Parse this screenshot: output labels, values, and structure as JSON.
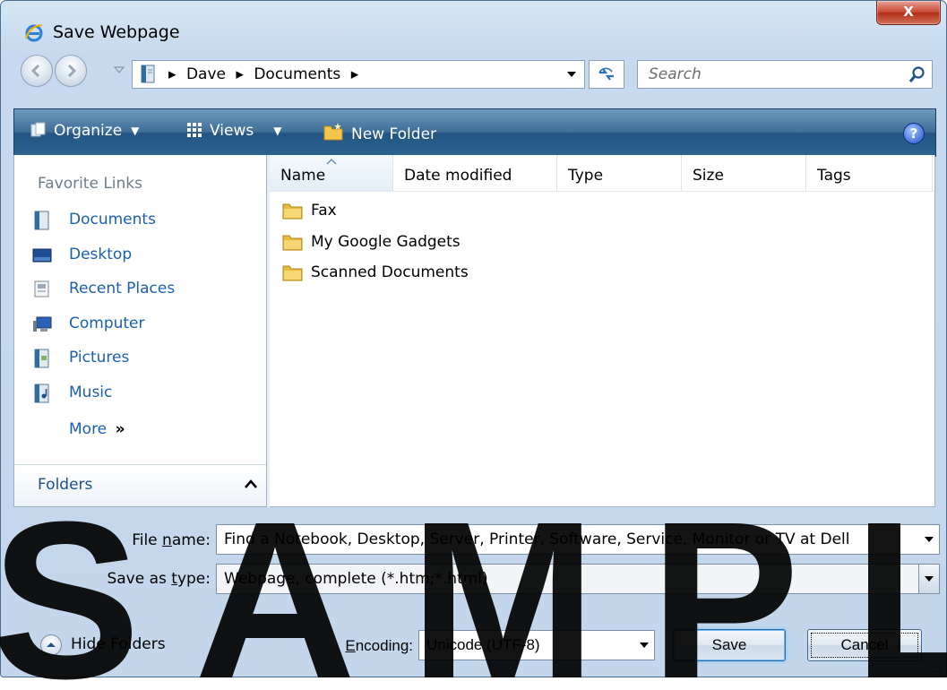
{
  "window": {
    "title": "Save Webpage",
    "close_label": "X"
  },
  "address": {
    "crumbs": [
      "Dave",
      "Documents"
    ],
    "search_placeholder": "Search"
  },
  "toolbar": {
    "organize_label": "Organize",
    "views_label": "Views",
    "new_folder_label": "New Folder",
    "help_label": "?"
  },
  "nav_pane": {
    "favorites_title": "Favorite Links",
    "favorites": [
      {
        "label": "Documents",
        "icon": "documents-icon"
      },
      {
        "label": "Desktop",
        "icon": "desktop-icon"
      },
      {
        "label": "Recent Places",
        "icon": "recent-places-icon"
      },
      {
        "label": "Computer",
        "icon": "computer-icon"
      },
      {
        "label": "Pictures",
        "icon": "pictures-icon"
      },
      {
        "label": "Music",
        "icon": "music-icon"
      }
    ],
    "more_label": "More",
    "more_glyph": "»",
    "folders_label": "Folders"
  },
  "file_list": {
    "columns": [
      "Name",
      "Date modified",
      "Type",
      "Size",
      "Tags"
    ],
    "items": [
      "Fax",
      "My Google Gadgets",
      "Scanned Documents"
    ]
  },
  "form": {
    "file_name_label_pre": "File ",
    "file_name_label_ul": "n",
    "file_name_label_post": "ame:",
    "file_name_value": "Find a Notebook, Desktop, Server, Printer, Software, Service, Monitor or TV at Dell",
    "save_type_label_pre": "Save as ",
    "save_type_label_ul": "t",
    "save_type_label_post": "ype:",
    "save_type_value": "Webpage, complete (*.htm;*.html)",
    "encoding_label_ul": "E",
    "encoding_label_post": "ncoding:",
    "encoding_value": "Unicode (UTF-8)",
    "hide_folders_label": "Hide Folders",
    "save_button": "Save",
    "cancel_button": "Cancel"
  },
  "watermark": "SAMPLE",
  "colors": {
    "link_blue": "#1b5fb0",
    "toolbar_dark": "#235583",
    "window_bg": "#c6d9ee",
    "folder_yellow": "#e8b93c"
  }
}
